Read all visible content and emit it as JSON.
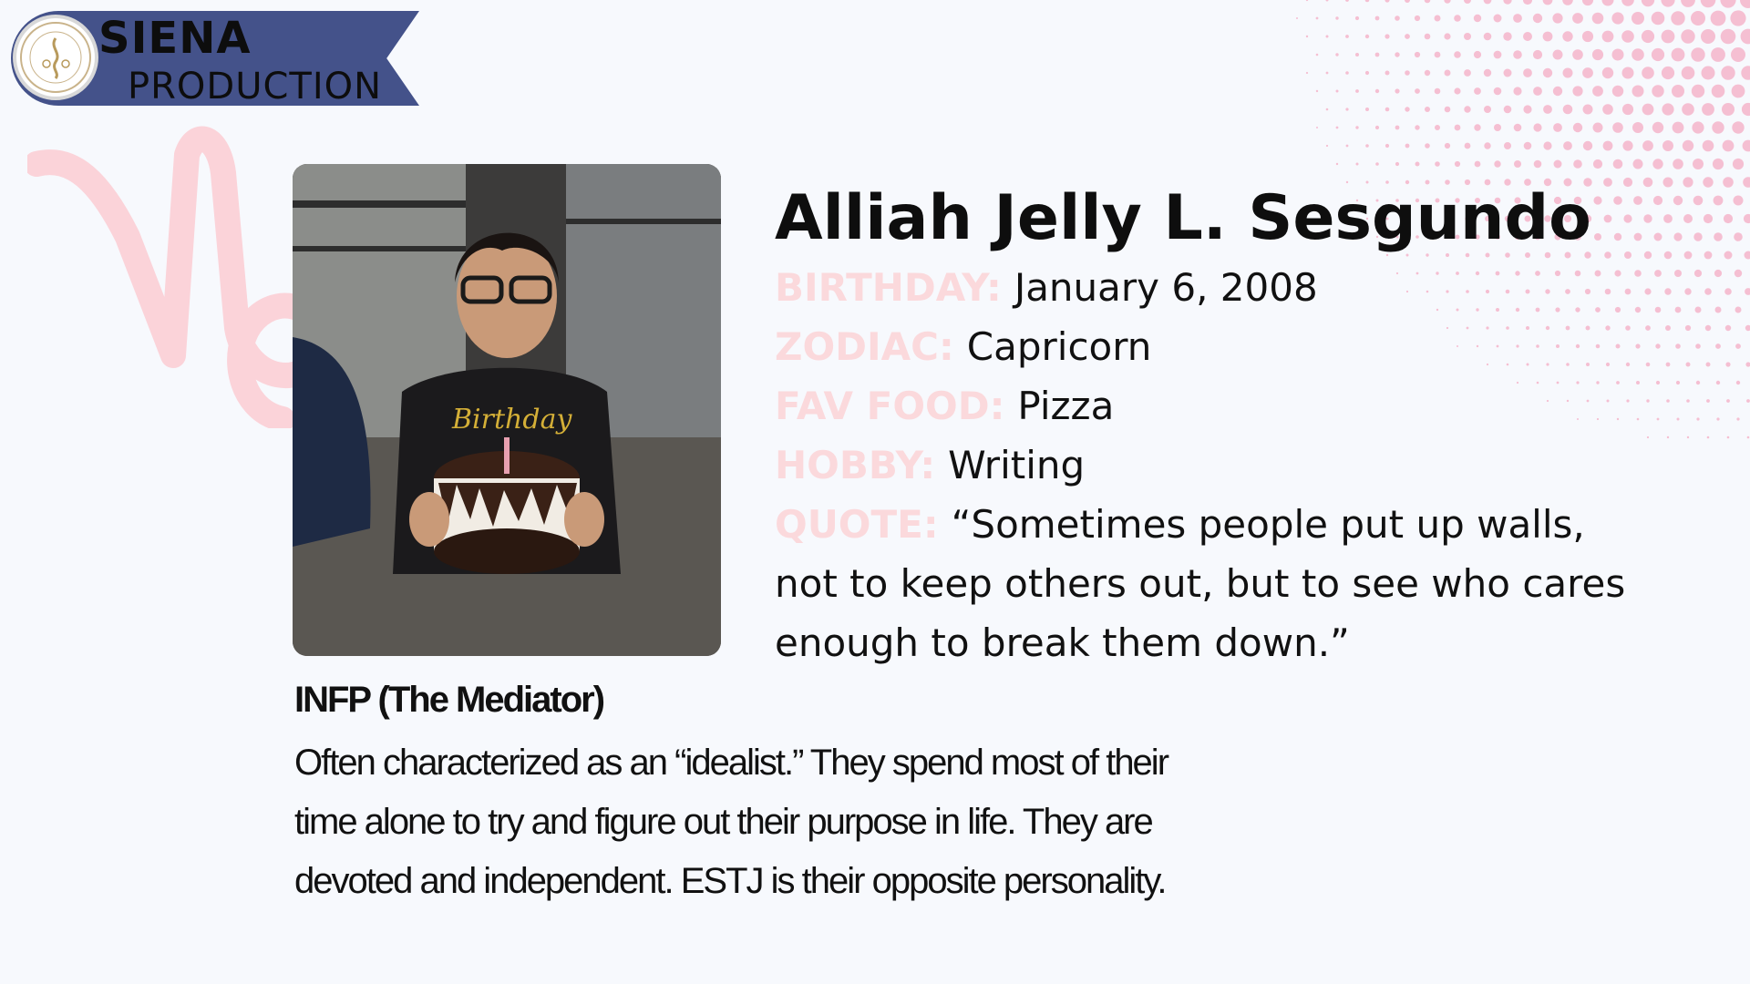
{
  "header": {
    "brand_line1": "SIENA",
    "brand_line2": "PRODUCTION",
    "logo_icon": "school-seal-icon"
  },
  "profile": {
    "name": "Alliah Jelly L. Sesgundo",
    "fields": [
      {
        "label": "BIRTHDAY:",
        "value": "January 6, 2008"
      },
      {
        "label": "ZODIAC:",
        "value": "Capricorn"
      },
      {
        "label": "FAV FOOD:",
        "value": "Pizza"
      },
      {
        "label": "HOBBY:",
        "value": "Writing"
      },
      {
        "label": "QUOTE:",
        "value": "“Sometimes people put up walls, not to keep others out, but to see who cares enough to break them down.”"
      }
    ],
    "photo_icon": "profile-photo",
    "zodiac_icon": "capricorn-icon"
  },
  "personality": {
    "title": "INFP (The Mediator)",
    "description": "Often characterized as an “idealist.” They spend most of their time alone to try and figure out their purpose in life. They are devoted and independent. ESTJ is their opposite personality."
  },
  "colors": {
    "banner": "#44528a",
    "label_pink": "#fbd9dc",
    "dots_pink": "#f7c6d6",
    "background": "#f7f9fd"
  }
}
